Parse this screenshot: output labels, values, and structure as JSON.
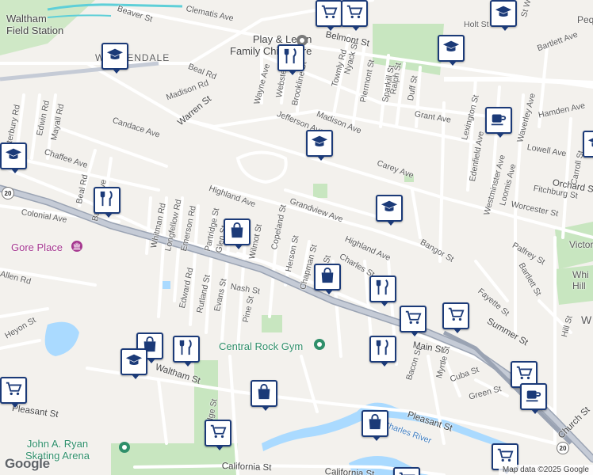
{
  "map": {
    "attribution": "Map data ©2025 Google",
    "logo": "Google",
    "route_shield": "20",
    "places": [
      {
        "name": "Waltham Field Station",
        "lines": [
          "Waltham",
          "Field Station"
        ]
      },
      {
        "name": "Gore Place",
        "icon": "museum-pin-icon"
      },
      {
        "name": "Central Rock Gym",
        "icon": "gym-pin-icon"
      },
      {
        "name": "John A. Ryan Skating Arena",
        "lines": [
          "John A. Ryan",
          "Skating Arena"
        ],
        "icon": "park-pin-icon"
      },
      {
        "name": "Play & Learn Family Child Care",
        "lines": [
          "Play & Learn",
          "Family Child Care"
        ],
        "icon": "school-pin-icon"
      }
    ],
    "area_labels": [
      "WARRENDALE",
      "Pequo",
      "Victory",
      "Whi",
      "Hill",
      "W"
    ],
    "streets": [
      "Beaver St",
      "Clematis Ave",
      "Belmont St",
      "Holt St",
      "St Walnut",
      "Beal Rd",
      "Madison Rd",
      "Warren St",
      "Wayne Ave",
      "Webster St",
      "Brookline St",
      "Townly Rd",
      "Nyack St",
      "Piermont St",
      "Ralph St",
      "Sparkill St",
      "Duff St",
      "Grant Ave",
      "Lexington St",
      "Hamden Ave",
      "Waverley Ave",
      "Lowell Ave",
      "Carroll St",
      "Orchard St",
      "Fitchburg St",
      "Worcester St",
      "Loomis Ave",
      "Westminster Ave",
      "Edenfield Ave",
      "Jefferson Ave",
      "Madison Ave",
      "Carey Ave",
      "Canterbury Rd",
      "Edwin Rd",
      "Mayall Rd",
      "Candace Ave",
      "Chaffee Ave",
      "Beal Rd",
      "Bartlett Ave",
      "Colonial Ave",
      "Whitman Rd",
      "Longfellow Rd",
      "Emerson Rd",
      "Partridge St",
      "Glen St",
      "Wilmot St",
      "Copeland St",
      "Herson St",
      "Chapman St",
      "Grandview Ave",
      "Highland Ave",
      "Highland Ave",
      "Charles St",
      "Olcott St",
      "Edward Rd",
      "Rutland St",
      "Evans St",
      "Nash St",
      "Pine St",
      "Allen Rd",
      "Heyon St",
      "Palfrey St",
      "Bartlett St",
      "Fayette St",
      "Summer St",
      "Hill St",
      "Main St",
      "Myrtle St",
      "Cuba St",
      "Green St",
      "Bacon St",
      "Waltham St",
      "Pleasant St",
      "Pleasant St",
      "Bridge St",
      "Church St",
      "California St",
      "California St",
      "Charles River",
      "Bartlett Ave",
      "Bangor St"
    ],
    "markers": [
      {
        "type": "shopping-cart",
        "label": "grocery-store-marker"
      },
      {
        "type": "shopping-cart",
        "label": "grocery-store-marker"
      },
      {
        "type": "school",
        "label": "school-marker"
      },
      {
        "type": "restaurant",
        "label": "restaurant-marker"
      },
      {
        "type": "school",
        "label": "school-marker"
      },
      {
        "type": "school",
        "label": "school-marker"
      },
      {
        "type": "coffee",
        "label": "cafe-marker"
      },
      {
        "type": "school",
        "label": "school-marker"
      },
      {
        "type": "school",
        "label": "school-marker"
      },
      {
        "type": "restaurant",
        "label": "restaurant-marker"
      },
      {
        "type": "school",
        "label": "school-marker"
      },
      {
        "type": "shopping-bag",
        "label": "store-marker"
      },
      {
        "type": "school",
        "label": "school-marker"
      },
      {
        "type": "shopping-bag",
        "label": "store-marker"
      },
      {
        "type": "restaurant",
        "label": "restaurant-marker"
      },
      {
        "type": "shopping-cart",
        "label": "grocery-store-marker"
      },
      {
        "type": "shopping-cart",
        "label": "grocery-store-marker"
      },
      {
        "type": "restaurant",
        "label": "restaurant-marker"
      },
      {
        "type": "shopping-bag",
        "label": "store-marker"
      },
      {
        "type": "school",
        "label": "school-marker"
      },
      {
        "type": "restaurant",
        "label": "restaurant-marker"
      },
      {
        "type": "shopping-cart",
        "label": "grocery-store-marker"
      },
      {
        "type": "coffee",
        "label": "cafe-marker"
      },
      {
        "type": "shopping-bag",
        "label": "store-marker"
      },
      {
        "type": "shopping-bag",
        "label": "store-marker"
      },
      {
        "type": "shopping-cart",
        "label": "grocery-store-marker"
      },
      {
        "type": "shopping-cart",
        "label": "grocery-store-marker"
      },
      {
        "type": "shopping-cart",
        "label": "grocery-store-marker"
      },
      {
        "type": "shopping-cart",
        "label": "grocery-store-marker"
      }
    ],
    "colors": {
      "marker_border": "#1b3a78",
      "road": "#ffffff",
      "highway": "#9aa3b3",
      "water": "#aadaff",
      "park": "#c8e6c0",
      "land": "#f3f1ed"
    }
  }
}
